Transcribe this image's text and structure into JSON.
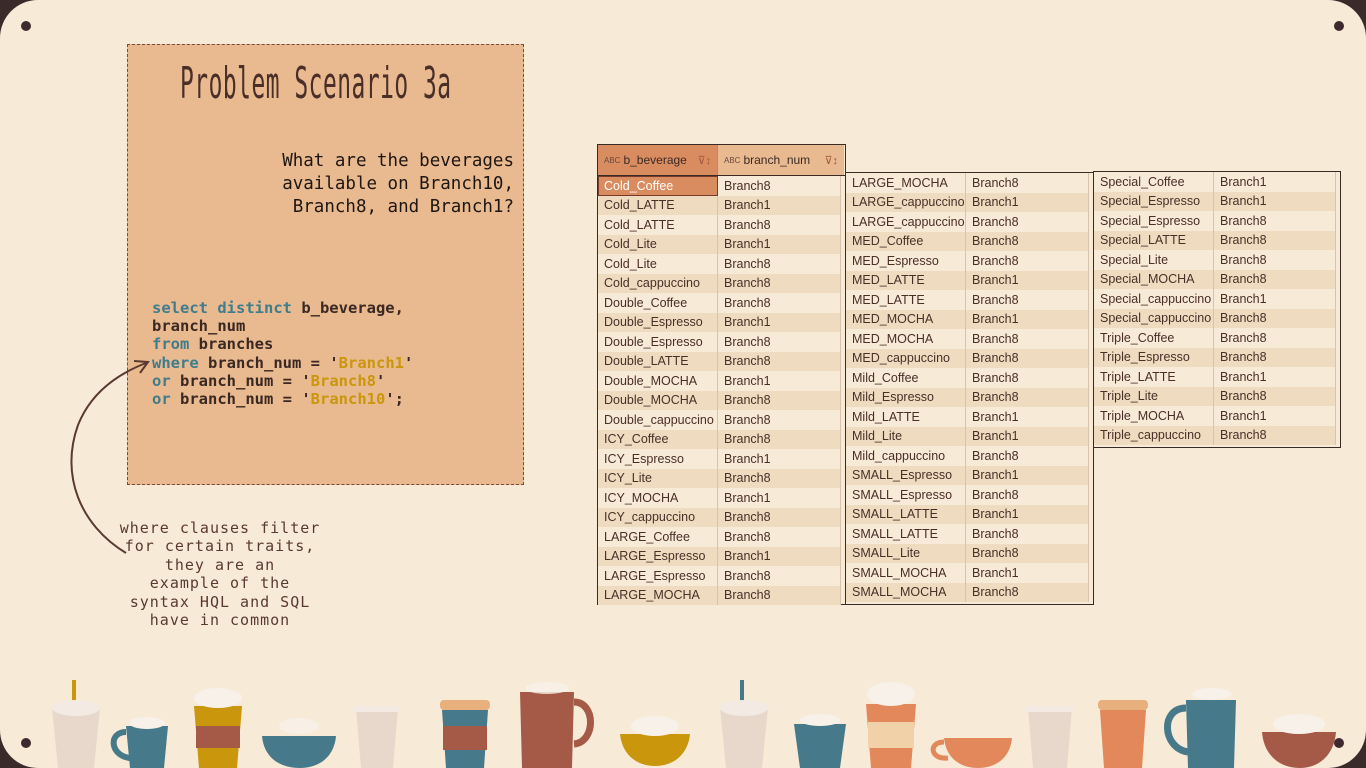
{
  "slide": {
    "title": "Problem Scenario 3a",
    "question_lines": [
      "What are the beverages",
      "available on Branch10,",
      "Branch8, and Branch1?"
    ],
    "note_lines": [
      "where clauses filter",
      "for certain traits,",
      "they are an",
      "example of the",
      "syntax HQL and SQL",
      "have in common"
    ]
  },
  "code": {
    "line1_kw": "select distinct",
    "line1_rest": " b_beverage,",
    "line2": "branch_num",
    "line3_kw": "from",
    "line3_rest": " branches",
    "line4_kw": "where",
    "line4_rest": " branch_num = '",
    "line4_str": "Branch1",
    "line4_end": "'",
    "line5_kw": "or",
    "line5_rest": " branch_num = '",
    "line5_str": "Branch8",
    "line5_end": "'",
    "line6_kw": "or",
    "line6_rest": " branch_num = '",
    "line6_str": "Branch10",
    "line6_end": "';"
  },
  "result": {
    "headers": {
      "abc_icon": "ABC",
      "col1": "b_beverage",
      "col2": "branch_num"
    },
    "col1_rows": [
      [
        "Cold_Coffee",
        "Branch8"
      ],
      [
        "Cold_LATTE",
        "Branch1"
      ],
      [
        "Cold_LATTE",
        "Branch8"
      ],
      [
        "Cold_Lite",
        "Branch1"
      ],
      [
        "Cold_Lite",
        "Branch8"
      ],
      [
        "Cold_cappuccino",
        "Branch8"
      ],
      [
        "Double_Coffee",
        "Branch8"
      ],
      [
        "Double_Espresso",
        "Branch1"
      ],
      [
        "Double_Espresso",
        "Branch8"
      ],
      [
        "Double_LATTE",
        "Branch8"
      ],
      [
        "Double_MOCHA",
        "Branch1"
      ],
      [
        "Double_MOCHA",
        "Branch8"
      ],
      [
        "Double_cappuccino",
        "Branch8"
      ],
      [
        "ICY_Coffee",
        "Branch8"
      ],
      [
        "ICY_Espresso",
        "Branch1"
      ],
      [
        "ICY_Lite",
        "Branch8"
      ],
      [
        "ICY_MOCHA",
        "Branch1"
      ],
      [
        "ICY_cappuccino",
        "Branch8"
      ],
      [
        "LARGE_Coffee",
        "Branch8"
      ],
      [
        "LARGE_Espresso",
        "Branch1"
      ],
      [
        "LARGE_Espresso",
        "Branch8"
      ],
      [
        "LARGE_MOCHA",
        "Branch8"
      ]
    ],
    "col2_rows": [
      [
        "LARGE_MOCHA",
        "Branch8"
      ],
      [
        "LARGE_cappuccino",
        "Branch1"
      ],
      [
        "LARGE_cappuccino",
        "Branch8"
      ],
      [
        "MED_Coffee",
        "Branch8"
      ],
      [
        "MED_Espresso",
        "Branch8"
      ],
      [
        "MED_LATTE",
        "Branch1"
      ],
      [
        "MED_LATTE",
        "Branch8"
      ],
      [
        "MED_MOCHA",
        "Branch1"
      ],
      [
        "MED_MOCHA",
        "Branch8"
      ],
      [
        "MED_cappuccino",
        "Branch8"
      ],
      [
        "Mild_Coffee",
        "Branch8"
      ],
      [
        "Mild_Espresso",
        "Branch8"
      ],
      [
        "Mild_LATTE",
        "Branch1"
      ],
      [
        "Mild_Lite",
        "Branch1"
      ],
      [
        "Mild_cappuccino",
        "Branch8"
      ],
      [
        "SMALL_Espresso",
        "Branch1"
      ],
      [
        "SMALL_Espresso",
        "Branch8"
      ],
      [
        "SMALL_LATTE",
        "Branch1"
      ],
      [
        "SMALL_LATTE",
        "Branch8"
      ],
      [
        "SMALL_Lite",
        "Branch8"
      ],
      [
        "SMALL_MOCHA",
        "Branch1"
      ],
      [
        "SMALL_MOCHA",
        "Branch8"
      ]
    ],
    "col3_rows": [
      [
        "Special_Coffee",
        "Branch1"
      ],
      [
        "Special_Espresso",
        "Branch1"
      ],
      [
        "Special_Espresso",
        "Branch8"
      ],
      [
        "Special_LATTE",
        "Branch8"
      ],
      [
        "Special_Lite",
        "Branch8"
      ],
      [
        "Special_MOCHA",
        "Branch8"
      ],
      [
        "Special_cappuccino",
        "Branch1"
      ],
      [
        "Special_cappuccino",
        "Branch8"
      ],
      [
        "Triple_Coffee",
        "Branch8"
      ],
      [
        "Triple_Espresso",
        "Branch8"
      ],
      [
        "Triple_LATTE",
        "Branch1"
      ],
      [
        "Triple_Lite",
        "Branch8"
      ],
      [
        "Triple_MOCHA",
        "Branch1"
      ],
      [
        "Triple_cappuccino",
        "Branch8"
      ]
    ]
  },
  "colors": {
    "background": "#f7ead7",
    "panel": "#e9b98f",
    "keyword": "#3f7c8c",
    "string": "#c9960c",
    "row_alt": "#efdcc0"
  }
}
